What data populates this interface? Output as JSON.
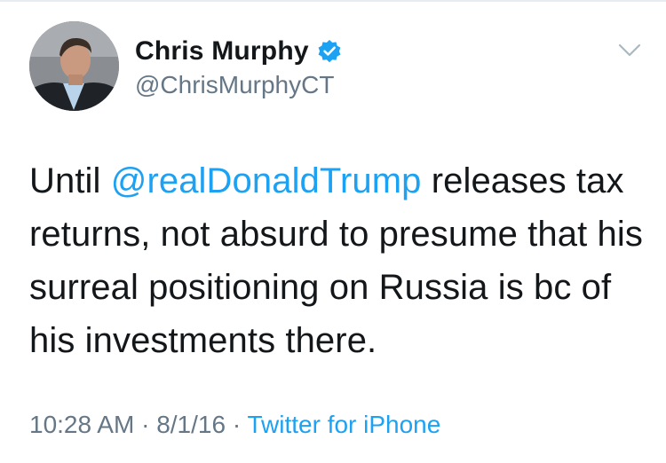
{
  "tweet": {
    "author_name": "Chris Murphy",
    "handle": "@ChrisMurphyCT",
    "text_before": "Until ",
    "mention": "@realDonaldTrump",
    "text_after": " releases tax returns, not absurd to presume that his surreal positioning on Russia is bc of his investments there.",
    "time": "10:28 AM",
    "separator": " · ",
    "date": "8/1/16",
    "source": "Twitter for iPhone"
  },
  "colors": {
    "accent": "#1da1f2",
    "text": "#14171a",
    "secondary": "#657786"
  },
  "icons": {
    "verified": "verified-badge-icon",
    "more": "chevron-down-icon"
  }
}
